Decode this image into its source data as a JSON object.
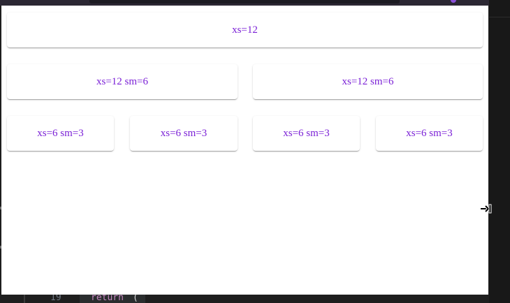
{
  "grid": {
    "row1": [
      {
        "label": "xs=12"
      }
    ],
    "row2": [
      {
        "label": "xs=12 sm=6"
      },
      {
        "label": "xs=12 sm=6"
      }
    ],
    "row3": [
      {
        "label": "xs=6 sm=3"
      },
      {
        "label": "xs=6 sm=3"
      },
      {
        "label": "xs=6 sm=3"
      },
      {
        "label": "xs=6 sm=3"
      }
    ]
  },
  "code": {
    "line_number": "19",
    "keyword": "return",
    "paren": "("
  },
  "colors": {
    "text_accent": "#7a1fd6",
    "editor_bg": "#1e1e1e"
  },
  "icons": {
    "cursor": "tab-arrow-icon"
  }
}
